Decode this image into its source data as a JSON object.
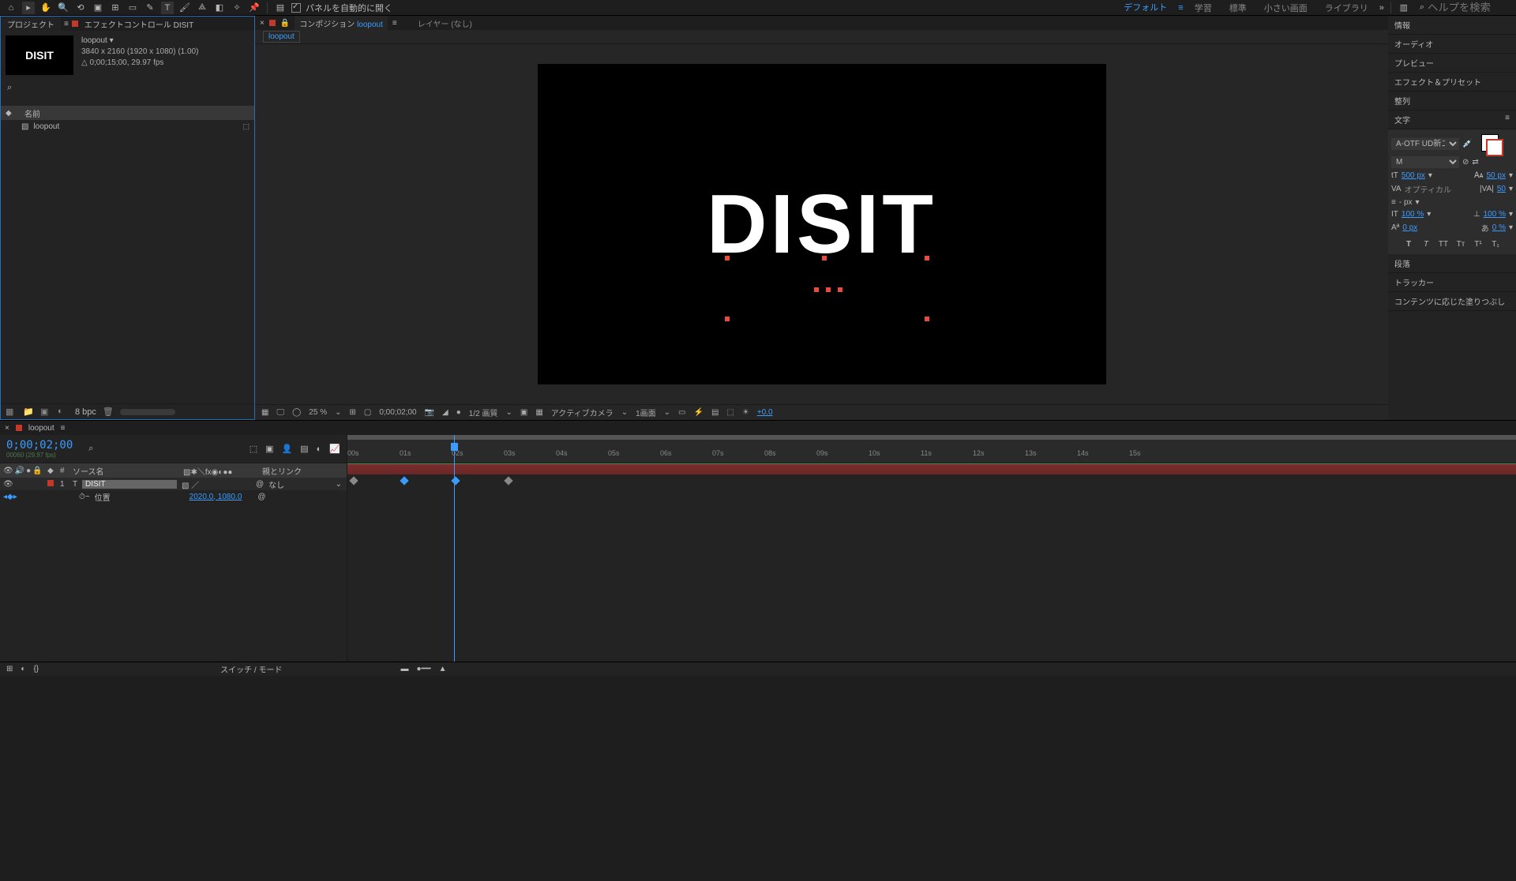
{
  "topbar": {
    "autopanel_label": "パネルを自動的に開く",
    "workspaces": [
      "デフォルト",
      "学習",
      "標準",
      "小さい画面",
      "ライブラリ"
    ],
    "active_workspace": "デフォルト",
    "search_placeholder": "ヘルプを検索"
  },
  "project": {
    "tab": "プロジェクト",
    "effect_tab": "エフェクトコントロール DISIT",
    "comp_name": "loopout",
    "comp_dims": "3840 x 2160  (1920 x 1080) (1.00)",
    "comp_dur": "△ 0;00;15;00, 29.97 fps",
    "header_name": "名前",
    "items": [
      {
        "name": "loopout"
      }
    ],
    "bpc": "8 bpc",
    "thumb_text": "DISIT"
  },
  "composition": {
    "tab_prefix": "コンポジション",
    "tab_name": "loopout",
    "layer_tab": "レイヤー (なし)",
    "breadcrumb": "loopout",
    "canvas_text": "DISIT"
  },
  "viewer_footer": {
    "zoom": "25 %",
    "time": "0;00;02;00",
    "res": "1/2 画質",
    "camera": "アクティブカメラ",
    "views": "1画面",
    "exposure": "+0.0"
  },
  "right": {
    "sections": [
      "情報",
      "オーディオ",
      "プレビュー",
      "エフェクト＆プリセット",
      "整列"
    ],
    "char_title": "文字",
    "font": "A-OTF UD新ゴNT ...",
    "weight": "M",
    "size": "500 px",
    "leading": "50 px",
    "kerning": "オプティカル",
    "tracking": "50",
    "strokew": "- px",
    "vscale": "100 %",
    "hscale": "100 %",
    "baseline": "0 px",
    "tsume": "0 %",
    "sections2": [
      "段落",
      "トラッカー",
      "コンテンツに応じた塗りつぶし"
    ]
  },
  "timeline": {
    "tab": "loopout",
    "timecode": "0;00;02;00",
    "framecode": "00060 (29.97 fps)",
    "cols": {
      "num": "#",
      "src": "ソース名",
      "parent": "親とリンク"
    },
    "layer": {
      "num": "1",
      "type": "T",
      "name": "DISIT",
      "parent": "なし"
    },
    "prop": {
      "name": "位置",
      "value": "2020.0, 1080.0"
    },
    "ruler": [
      "00s",
      "01s",
      "02s",
      "03s",
      "04s",
      "05s",
      "06s",
      "07s",
      "08s",
      "09s",
      "10s",
      "11s",
      "12s",
      "13s",
      "14s",
      "15s"
    ]
  },
  "bottom": {
    "switches": "スイッチ / モード"
  }
}
